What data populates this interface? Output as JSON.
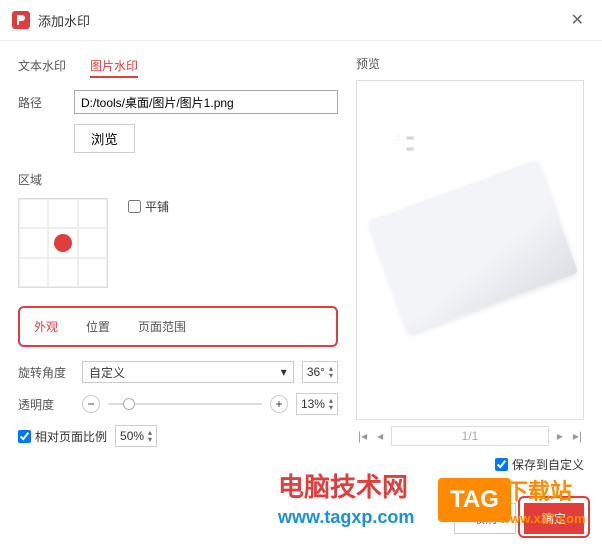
{
  "titlebar": {
    "title": "添加水印",
    "close": "✕"
  },
  "tabs": {
    "text": "文本水印",
    "image": "图片水印"
  },
  "path": {
    "label": "路径",
    "value": "D:/tools/桌面/图片/图片1.png",
    "browse": "浏览"
  },
  "region": {
    "label": "区域",
    "tile": "平铺"
  },
  "sub_tabs": {
    "appearance": "外观",
    "position": "位置",
    "range": "页面范围"
  },
  "rotate": {
    "label": "旋转角度",
    "mode": "自定义",
    "value": "36°"
  },
  "opacity": {
    "label": "透明度",
    "value": "13%"
  },
  "relative": {
    "label": "相对页面比例",
    "value": "50%"
  },
  "preview": {
    "label": "预览",
    "page": "1/1",
    "save": "保存到自定义"
  },
  "buttons": {
    "cancel": "取消",
    "ok": "确定"
  },
  "overlay": {
    "t1": "电脑技术网",
    "t2": "www.tagxp.com",
    "tag": "TAG",
    "t3": "下载站",
    "t4": "www.x27.com"
  }
}
